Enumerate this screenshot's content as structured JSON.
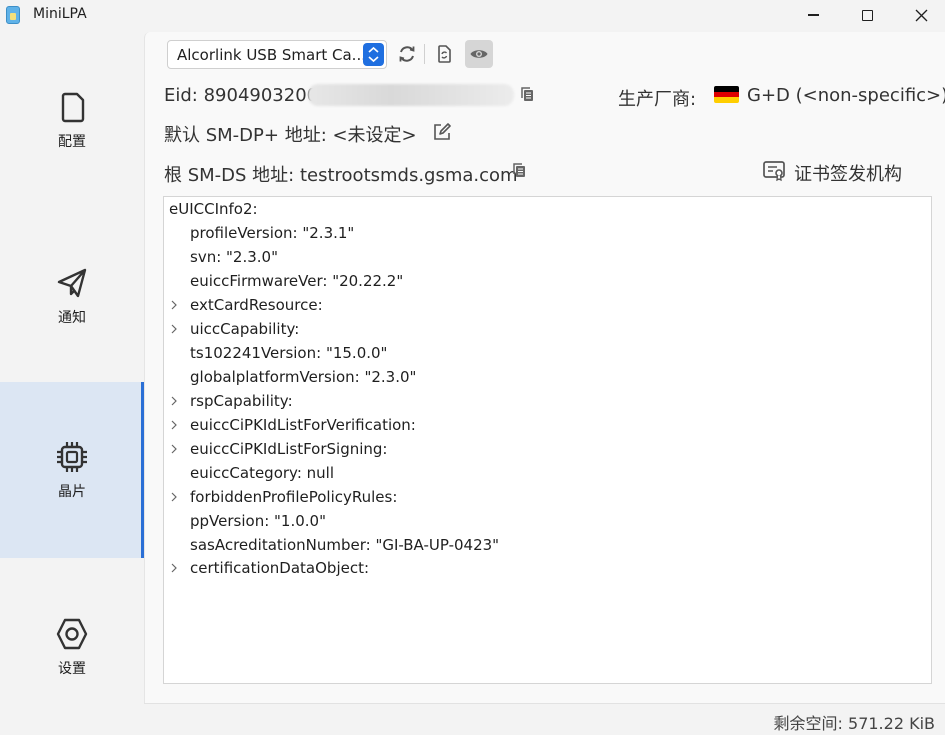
{
  "window": {
    "title": "MiniLPA",
    "minimize_icon": "minimize-icon",
    "maximize_icon": "maximize-icon",
    "close_icon": "close-icon"
  },
  "sidebar": {
    "items": [
      {
        "label": "配置",
        "icon": "sim-card-icon",
        "active": false
      },
      {
        "label": "通知",
        "icon": "paper-plane-icon",
        "active": false
      },
      {
        "label": "晶片",
        "icon": "chip-icon",
        "active": true
      },
      {
        "label": "设置",
        "icon": "settings-hex-icon",
        "active": false
      }
    ]
  },
  "toolbar": {
    "reader_selected": "Alcorlink USB Smart Ca...",
    "refresh_icon": "refresh-icon",
    "switch_icon": "switch-card-icon",
    "view_icon": "eye-icon"
  },
  "info": {
    "eid_label": "Eid: 89049032000",
    "manufacturer_label": "生产厂商:",
    "manufacturer_value": "G+D (<non-specific>)",
    "default_smdp_label": "默认 SM-DP+ 地址: <未设定>",
    "root_smds_label": "根 SM-DS 地址: testrootsmds.gsma.com",
    "certificate_issuer_label": "证书签发机构"
  },
  "tree": {
    "root": "eUICCInfo2:",
    "children": [
      {
        "text": "profileVersion: \"2.3.1\"",
        "expandable": false
      },
      {
        "text": "svn: \"2.3.0\"",
        "expandable": false
      },
      {
        "text": "euiccFirmwareVer: \"20.22.2\"",
        "expandable": false
      },
      {
        "text": "extCardResource:",
        "expandable": true
      },
      {
        "text": "uiccCapability:",
        "expandable": true
      },
      {
        "text": "ts102241Version: \"15.0.0\"",
        "expandable": false
      },
      {
        "text": "globalplatformVersion: \"2.3.0\"",
        "expandable": false
      },
      {
        "text": "rspCapability:",
        "expandable": true
      },
      {
        "text": "euiccCiPKIdListForVerification:",
        "expandable": true
      },
      {
        "text": "euiccCiPKIdListForSigning:",
        "expandable": true
      },
      {
        "text": "euiccCategory: null",
        "expandable": false
      },
      {
        "text": "forbiddenProfilePolicyRules:",
        "expandable": true
      },
      {
        "text": "ppVersion: \"1.0.0\"",
        "expandable": false
      },
      {
        "text": "sasAcreditationNumber: \"GI-BA-UP-0423\"",
        "expandable": false
      },
      {
        "text": "certificationDataObject:",
        "expandable": true
      }
    ]
  },
  "status": {
    "free_space": "剩余空间: 571.22 KiB"
  },
  "colors": {
    "accent": "#2a6fd6",
    "active_nav_bg": "#dce6f3",
    "flag_black": "#000000",
    "flag_red": "#dd0000",
    "flag_gold": "#ffce00"
  }
}
